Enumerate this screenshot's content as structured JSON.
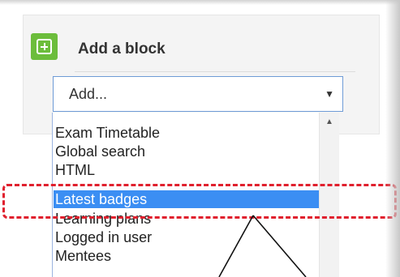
{
  "block": {
    "title": "Add a block"
  },
  "select": {
    "value": "Add..."
  },
  "dropdown": {
    "items": [
      {
        "label": "Exam Timetable"
      },
      {
        "label": "Global search"
      },
      {
        "label": "HTML"
      },
      {
        "label": "Latest badges"
      },
      {
        "label": "Learning plans"
      },
      {
        "label": "Logged in user"
      },
      {
        "label": "Mentees"
      }
    ],
    "selected_index": 3
  },
  "colors": {
    "add_icon": "#6cbd3b",
    "selection": "#3b8ef3",
    "highlight_border": "#e0202e"
  },
  "icons": {
    "add": "plus-square-icon",
    "select_toggle": "caret-down-icon",
    "scroll_up": "caret-up-icon"
  }
}
